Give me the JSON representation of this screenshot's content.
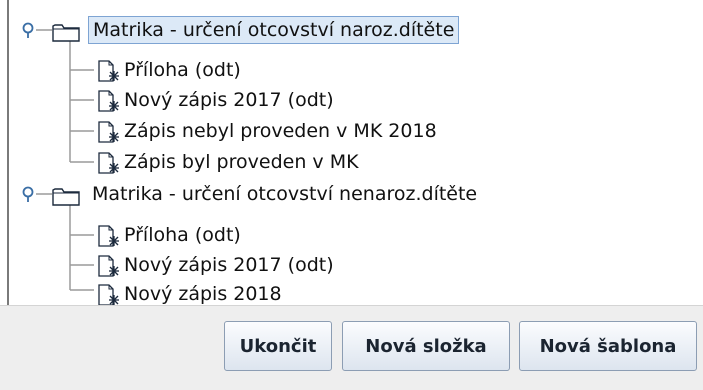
{
  "tree": {
    "folders": [
      {
        "label": "Matrika - určení otcovství naroz.dítěte",
        "selected": true,
        "templates": [
          {
            "label": "Příloha (odt)"
          },
          {
            "label": "Nový zápis 2017 (odt)"
          },
          {
            "label": "Zápis nebyl proveden v MK 2018"
          },
          {
            "label": "Zápis byl proveden v MK"
          }
        ]
      },
      {
        "label": "Matrika - určení otcovství nenaroz.dítěte",
        "selected": false,
        "templates": [
          {
            "label": "Příloha (odt)"
          },
          {
            "label": "Nový zápis 2017 (odt)"
          },
          {
            "label": "Nový zápis 2018"
          }
        ]
      }
    ]
  },
  "buttons": {
    "exit_label": "Ukončit",
    "new_folder_label": "Nová složka",
    "new_template_label": "Nová šablona"
  },
  "colors": {
    "selection_bg": "#dce9f7",
    "selection_border": "#7ea4d3",
    "button_border": "#8c9db3"
  },
  "icons": {
    "expanded_toggle": "expanded-node-toggle-icon",
    "folder": "folder-icon",
    "template": "document-template-icon"
  }
}
